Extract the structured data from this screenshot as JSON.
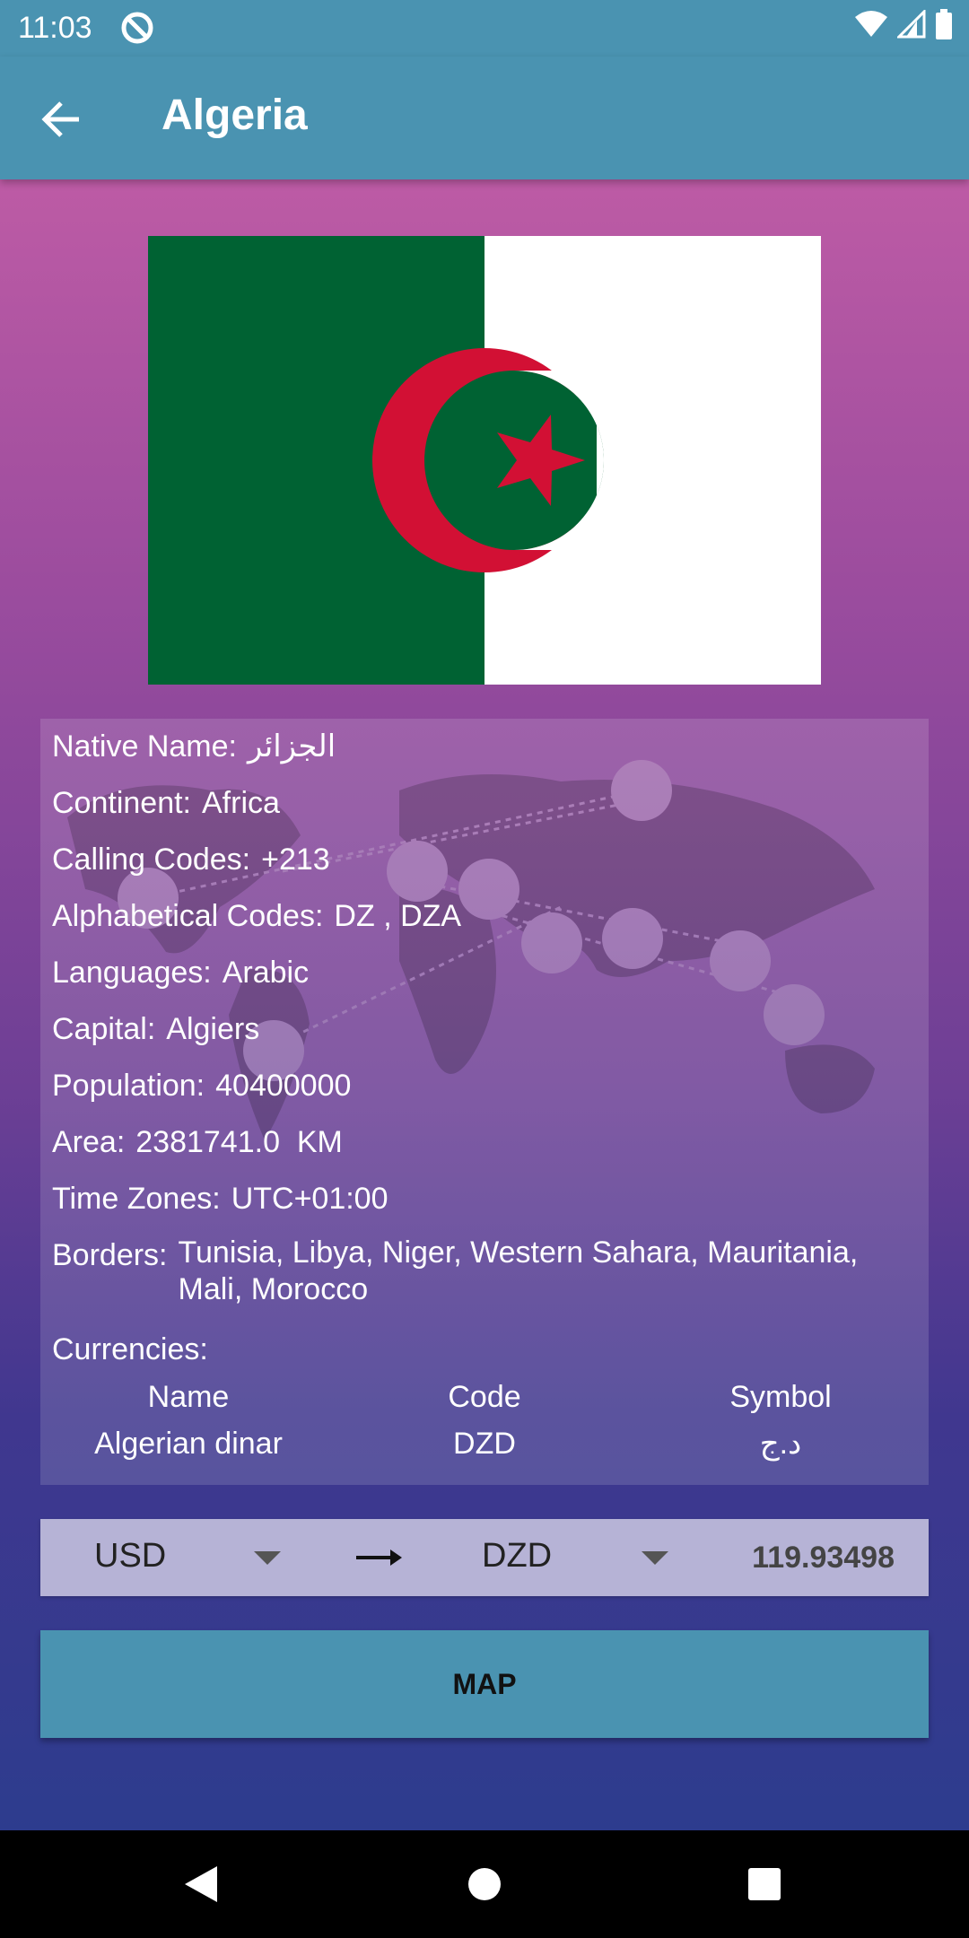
{
  "status_bar": {
    "time": "11:03"
  },
  "app_bar": {
    "title": "Algeria"
  },
  "info": {
    "native_name": {
      "label": "Native Name:",
      "value": "الجزائر"
    },
    "continent": {
      "label": "Continent:",
      "value": "Africa"
    },
    "calling_codes": {
      "label": "Calling Codes:",
      "value": "+213"
    },
    "alpha_codes": {
      "label": "Alphabetical Codes:",
      "value": "DZ , DZA"
    },
    "languages": {
      "label": "Languages:",
      "value": "Arabic"
    },
    "capital": {
      "label": "Capital:",
      "value": "Algiers"
    },
    "population": {
      "label": "Population:",
      "value": "40400000"
    },
    "area": {
      "label": "Area:",
      "value": "2381741.0  KM"
    },
    "time_zones": {
      "label": "Time Zones:",
      "value": "UTC+01:00"
    },
    "borders": {
      "label": "Borders:",
      "value": "Tunisia, Libya, Niger, Western Sahara, Mauritania, Mali, Morocco"
    },
    "currencies_label": "Currencies:"
  },
  "currencies": {
    "headers": [
      "Name",
      "Code",
      "Symbol"
    ],
    "rows": [
      [
        "Algerian dinar",
        "DZD",
        "د.ج"
      ]
    ]
  },
  "converter": {
    "from": "USD",
    "to": "DZD",
    "rate": "119.93498"
  },
  "map_button": {
    "label": "MAP"
  },
  "colors": {
    "app_bar": "#4a93b1",
    "flag_green": "#006233",
    "flag_white": "#ffffff",
    "flag_red": "#d21034"
  },
  "icons": {
    "back": "arrow-left-icon",
    "dnd": "do-not-disturb-icon",
    "wifi": "wifi-icon",
    "signal": "signal-icon",
    "battery": "battery-icon",
    "converter_arrow": "arrow-right-icon",
    "dropdown": "triangle-down-icon",
    "watermark": "world-map-currency-icon",
    "nav_back": "nav-back-icon",
    "nav_home": "nav-home-icon",
    "nav_recents": "nav-recents-icon"
  }
}
